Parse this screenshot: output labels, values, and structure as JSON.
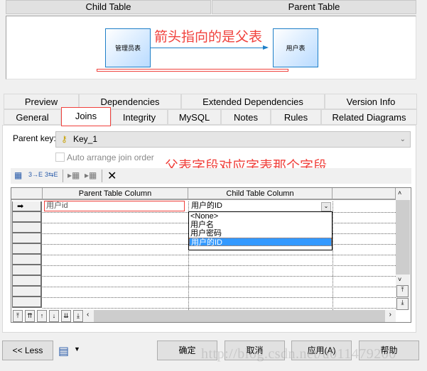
{
  "header": {
    "child_table": "Child Table",
    "parent_table": "Parent Table"
  },
  "diagram": {
    "child_box": "管理员表",
    "parent_box": "用户表",
    "annotation": "箭头指向的是父表",
    "link_color": "#1e7fc8"
  },
  "tabs_row1": [
    "Preview",
    "Dependencies",
    "Extended Dependencies",
    "Version Info"
  ],
  "tabs_row2": [
    "General",
    "Joins",
    "Integrity",
    "MySQL",
    "Notes",
    "Rules",
    "Related Diagrams"
  ],
  "active_tab": "Joins",
  "joins": {
    "parent_key_label": "Parent key:",
    "parent_key_value": "Key_1",
    "auto_arrange_label": "Auto arrange join order",
    "auto_arrange_checked": false,
    "annotation": "父表字段对应字表那个字段",
    "columns": [
      "Parent Table Column",
      "Child Table Column"
    ],
    "rows": [
      {
        "parent": "用户id",
        "child": "用户的ID"
      }
    ],
    "dropdown_options": [
      "<None>",
      "用户名",
      "用户密码",
      "用户的ID"
    ],
    "dropdown_selected": "用户的ID"
  },
  "footer": {
    "less": "<< Less",
    "ok": "确定",
    "cancel": "取消",
    "apply": "应用(A)",
    "help": "帮助"
  },
  "watermark": "http://blog.csdn.net/u011479200",
  "colors": {
    "annotation_red": "#f0413c",
    "selection_blue": "#3399ff"
  }
}
